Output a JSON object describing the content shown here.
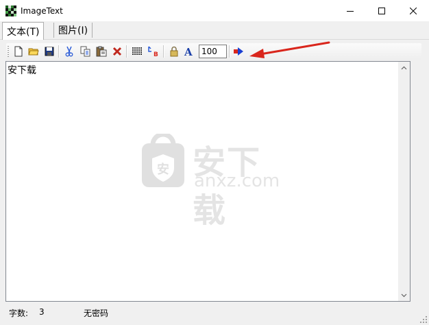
{
  "window": {
    "title": "ImageText"
  },
  "tabs": [
    {
      "label": "文本(T)"
    },
    {
      "label": "图片(I)"
    }
  ],
  "toolbar": {
    "icons": [
      "new-file-icon",
      "open-folder-icon",
      "save-icon",
      "cut-icon",
      "copy-icon",
      "paste-icon",
      "delete-icon",
      "grid-icon",
      "font-size-icon",
      "lock-icon",
      "font-icon",
      "run-arrow-icon"
    ],
    "zoom_value": "100"
  },
  "editor": {
    "text": "安下载"
  },
  "watermark": {
    "cn": "安下载",
    "en": "anxz.com",
    "badge": "安"
  },
  "status": {
    "char_count_label": "字数:",
    "char_count": "3",
    "password_status": "无密码"
  },
  "colors": {
    "accent_red": "#d9261c",
    "arrow_blue": "#1a3fd1",
    "window_bg": "#f0f0f0"
  }
}
